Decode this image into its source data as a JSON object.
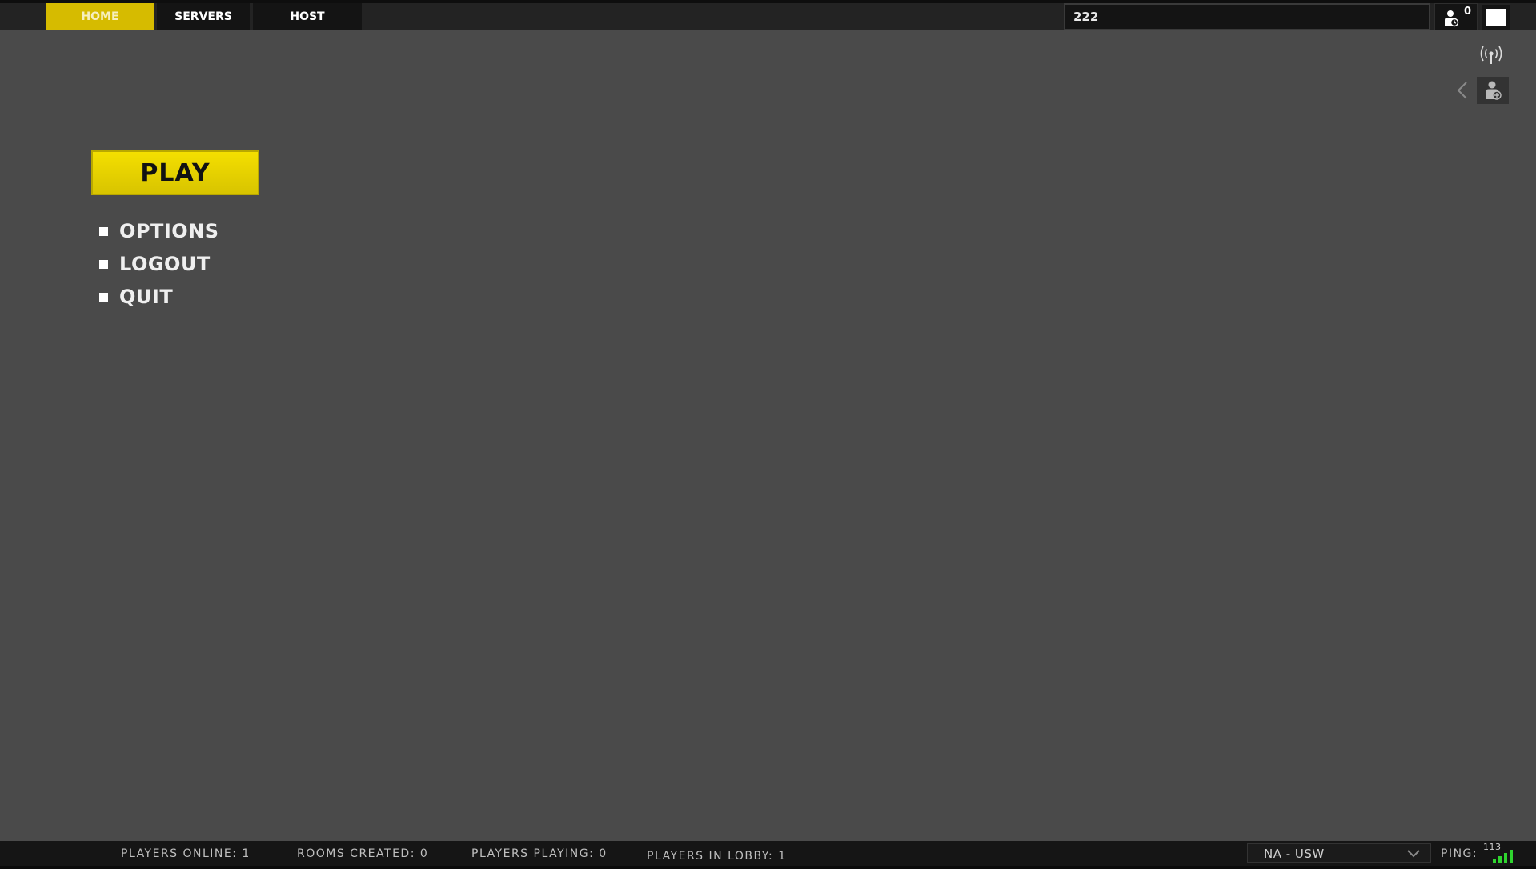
{
  "nav": {
    "tabs": [
      {
        "label": "HOME",
        "active": true
      },
      {
        "label": "SERVERS",
        "active": false
      },
      {
        "label": "HOST",
        "active": false
      }
    ]
  },
  "search": {
    "value": "222"
  },
  "friends": {
    "count": "0",
    "icon": "friends-icon"
  },
  "menu": {
    "play_label": "PLAY",
    "items": [
      {
        "label": "OPTIONS"
      },
      {
        "label": "LOGOUT"
      },
      {
        "label": "QUIT"
      }
    ]
  },
  "icons": {
    "antenna": "antenna-icon",
    "back": "chevron-left-icon",
    "add_friend": "add-friend-icon"
  },
  "status": {
    "players_online": "PLAYERS ONLINE: 1",
    "rooms_created": "ROOMS CREATED: 0",
    "players_playing": "PLAYERS PLAYING: 0",
    "players_in_lobby": "PLAYERS IN LOBBY: 1"
  },
  "region": {
    "selected": "NA - USW"
  },
  "ping": {
    "label": "PING:",
    "value": "113",
    "bars_lit": 4,
    "bars_total": 4
  },
  "colors": {
    "accent": "#f4df00",
    "tab_active": "#d6bb00",
    "background": "#4a4a4a",
    "signal": "#2fd42f"
  }
}
